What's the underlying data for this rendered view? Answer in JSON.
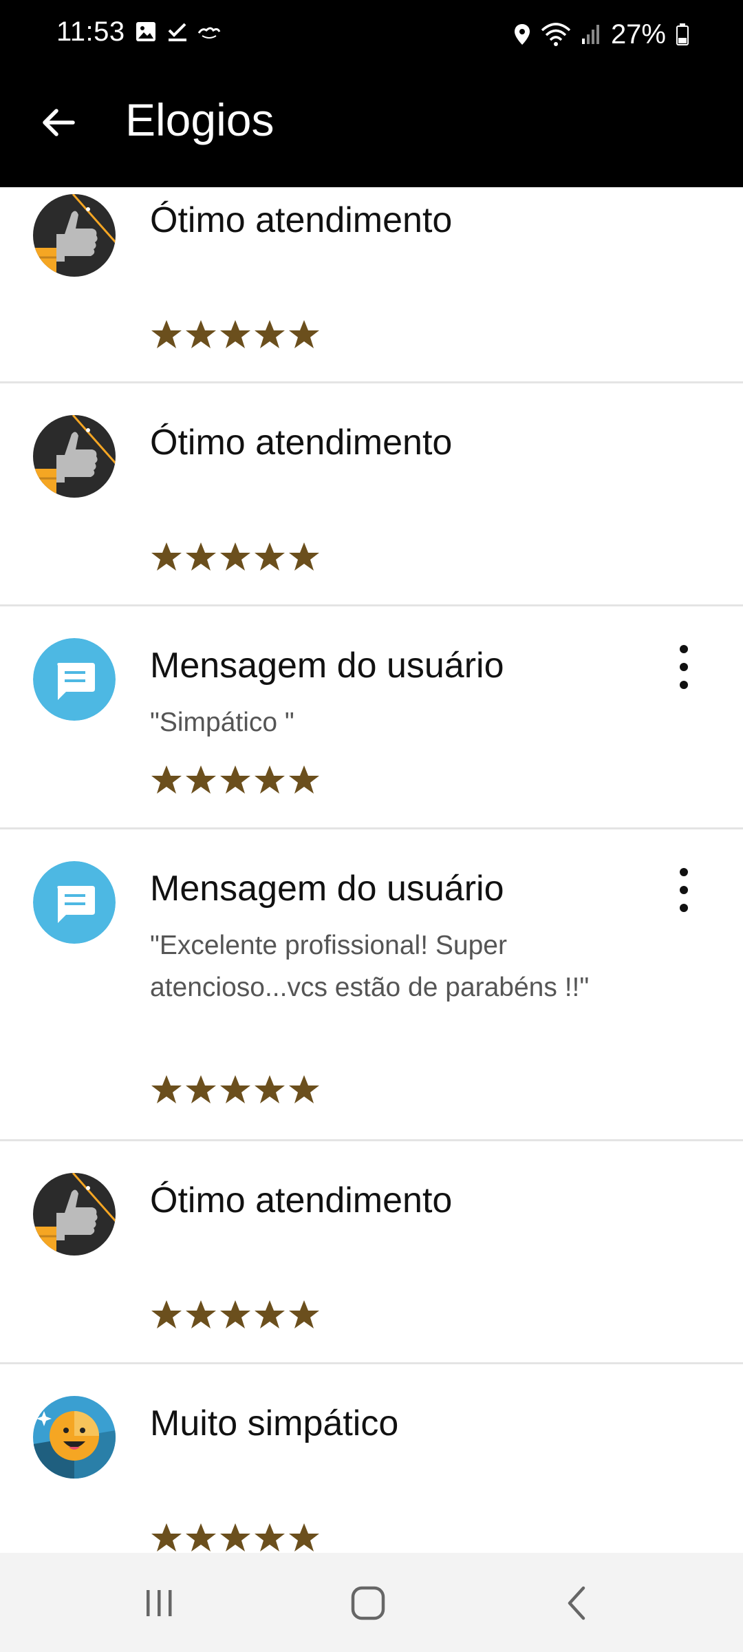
{
  "status_bar": {
    "time": "11:53",
    "battery": "27%",
    "icons": [
      "gallery-icon",
      "task-check-icon",
      "ifood-icon",
      "location-icon",
      "wifi-icon",
      "signal-icon",
      "battery-icon"
    ]
  },
  "app_bar": {
    "title": "Elogios",
    "back_icon": "arrow-left-icon"
  },
  "items": [
    {
      "type": "badge",
      "icon": "thumbs-up-badge-icon",
      "title": "Ótimo atendimento",
      "message": "",
      "rating": 5
    },
    {
      "type": "badge",
      "icon": "thumbs-up-badge-icon",
      "title": "Ótimo atendimento",
      "message": "",
      "rating": 5
    },
    {
      "type": "message",
      "icon": "chat-message-icon",
      "title": "Mensagem do usuário",
      "message": "\"Simpático \"",
      "rating": 5
    },
    {
      "type": "message",
      "icon": "chat-message-icon",
      "title": "Mensagem do usuário",
      "message": "\"Excelente profissional! Super atencioso...vcs estão de parabéns !!\"",
      "rating": 5
    },
    {
      "type": "badge",
      "icon": "thumbs-up-badge-icon",
      "title": "Ótimo atendimento",
      "message": "",
      "rating": 5
    },
    {
      "type": "badge",
      "icon": "smiley-badge-icon",
      "title": "Muito simpático",
      "message": "",
      "rating": 5
    }
  ],
  "colors": {
    "star": "#6b4f1d",
    "message_avatar": "#4db8e3",
    "badge_dark": "#2b2b2b",
    "badge_orange": "#f5a623"
  },
  "nav_bar": {
    "icons": [
      "recent-apps-icon",
      "home-icon",
      "back-icon"
    ]
  }
}
